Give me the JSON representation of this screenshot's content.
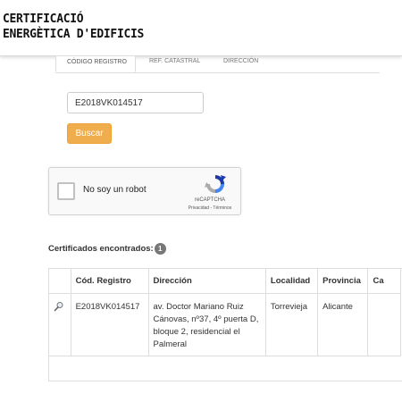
{
  "header": {
    "logo_line1": "CERTIFICACIÓ",
    "logo_line2": "ENERGÈTICA D'EDIFICIS"
  },
  "tabs": [
    {
      "label": "CÓDIGO REGISTRO",
      "active": true
    },
    {
      "label": "REF. CATASTRAL",
      "active": false
    },
    {
      "label": "DIRECCIÓN",
      "active": false
    }
  ],
  "search": {
    "value": "E2018VK014517",
    "button_label": "Buscar",
    "button_color": "#f0ad4e"
  },
  "recaptcha": {
    "label": "No soy un robot",
    "brand": "reCAPTCHA",
    "links": "Privacidad - Términos"
  },
  "results": {
    "title": "Certificados encontrados:",
    "count": "1",
    "columns": [
      "Cód. Registro",
      "Dirección",
      "Localidad",
      "Provincia",
      "Ca"
    ],
    "rows": [
      {
        "codigo": "E2018VK014517",
        "direccion": "av. Doctor Mariano Ruiz Cánovas, nº37, 4º puerta D, bloque 2, residencial el Palmeral",
        "localidad": "Torrevieja",
        "provincia": "Alicante",
        "ca": ""
      }
    ]
  }
}
